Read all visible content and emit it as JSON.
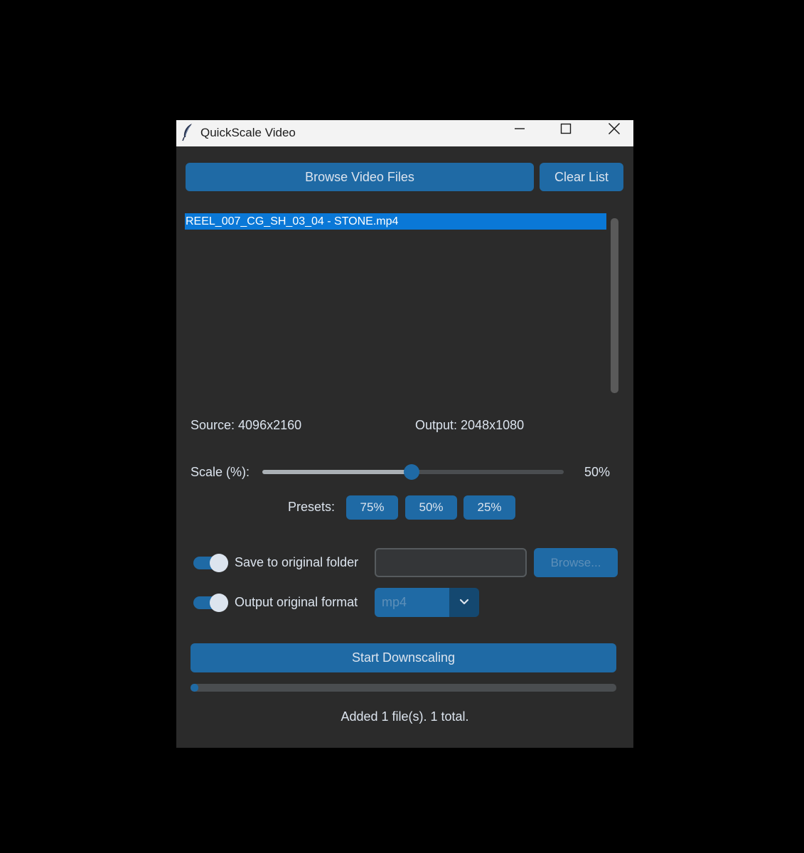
{
  "window": {
    "title": "QuickScale Video"
  },
  "toolbar": {
    "browse_files_label": "Browse Video Files",
    "clear_list_label": "Clear List"
  },
  "file_list": {
    "items": [
      "REEL_007_CG_SH_03_04 - STONE.mp4"
    ],
    "selected_index": 0
  },
  "resolution": {
    "source": "Source: 4096x2160",
    "output": "Output: 2048x1080"
  },
  "scale": {
    "label": "Scale (%):",
    "value": 50,
    "value_text": "50%",
    "min": 1,
    "max": 100
  },
  "presets": {
    "label": "Presets:",
    "options": [
      "75%",
      "50%",
      "25%"
    ]
  },
  "options": {
    "save_to_original_label": "Save to original folder",
    "save_to_original_on": true,
    "output_folder_value": "",
    "browse_folder_label": "Browse...",
    "output_original_format_label": "Output original format",
    "output_original_format_on": true,
    "format_selected": "mp4"
  },
  "actions": {
    "start_label": "Start Downscaling"
  },
  "progress": {
    "fraction": 0.012
  },
  "status": {
    "text": "Added 1 file(s). 1 total."
  },
  "colors": {
    "accent": "#1f6aa5",
    "selection": "#0a78d7",
    "background": "#2b2b2b",
    "text": "#dce4ee"
  },
  "icons": {
    "app": "feather-icon",
    "minimize": "minimize-icon",
    "maximize": "maximize-icon",
    "close": "close-icon",
    "dropdown": "chevron-down-icon"
  }
}
